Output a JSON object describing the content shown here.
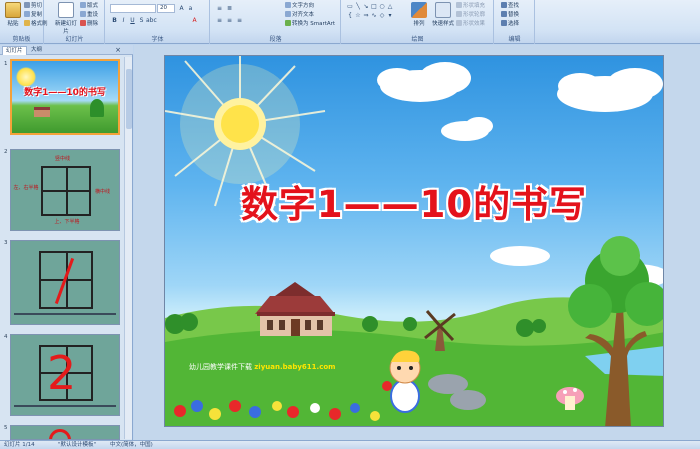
{
  "ribbon": {
    "clipboard": {
      "label": "剪贴板",
      "paste": "粘贴",
      "cut": "剪切",
      "copy": "复制",
      "format_painter": "格式刷"
    },
    "slides": {
      "label": "幻灯片",
      "new_slide": "新建幻灯片",
      "layout": "版式",
      "reset": "重设",
      "delete": "删除"
    },
    "font": {
      "label": "字体",
      "font_name": "",
      "font_size": "20"
    },
    "paragraph": {
      "label": "段落",
      "text_direction": "文字方向",
      "align_text": "对齐文本",
      "smartart": "转换为 SmartArt"
    },
    "drawing": {
      "label": "绘图",
      "arrange": "排列",
      "quick_styles": "快速样式",
      "shape_fill": "形状填充",
      "shape_outline": "形状轮廓",
      "shape_effects": "形状效果"
    },
    "editing": {
      "label": "编辑",
      "find": "查找",
      "replace": "替换",
      "select": "选择"
    }
  },
  "pane": {
    "tab_slides": "幻灯片",
    "tab_outline": "大纲",
    "thumbs": [
      {
        "num": "1",
        "title": "数字1——10的书写"
      },
      {
        "num": "2",
        "labels": [
          "竖中线",
          "左、右半格",
          "横中线",
          "上、下半格"
        ]
      },
      {
        "num": "3",
        "caption": ""
      },
      {
        "num": "4",
        "caption": ""
      },
      {
        "num": "5"
      }
    ]
  },
  "slide": {
    "title": "数字1——10的书写",
    "credit_text": "幼儿园教学课件下载",
    "credit_url": "ziyuan.baby611.com"
  },
  "status": {
    "slide_count": "幻灯片 1/14",
    "theme": "\"默认设计模板\"",
    "language": "中文(简体，中国)"
  },
  "colors": {
    "title": "#e4121b",
    "sky_top": "#2f93e0",
    "grass": "#52b636",
    "selection": "#f4a23a"
  }
}
